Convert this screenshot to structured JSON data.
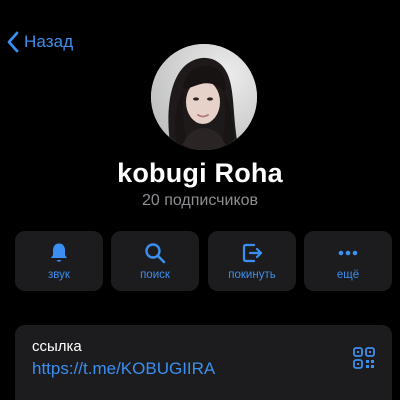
{
  "nav": {
    "back_label": "Назад",
    "back_icon": "chevron-left-icon"
  },
  "profile": {
    "name": "kobugi Roha",
    "subtitle": "20 подписчиков"
  },
  "actions": [
    {
      "label": "звук",
      "icon": "bell-icon"
    },
    {
      "label": "поиск",
      "icon": "search-icon"
    },
    {
      "label": "покинуть",
      "icon": "leave-icon"
    },
    {
      "label": "ещё",
      "icon": "more-icon"
    }
  ],
  "info": {
    "caption": "ссылка",
    "link": "https://t.me/KOBUGIIRA",
    "qr_icon": "qr-code-icon"
  },
  "colors": {
    "background": "#000000",
    "card": "#1c1c1e",
    "accent": "#3b8ff0",
    "text": "#ffffff",
    "secondary_text": "#8e8e93"
  }
}
